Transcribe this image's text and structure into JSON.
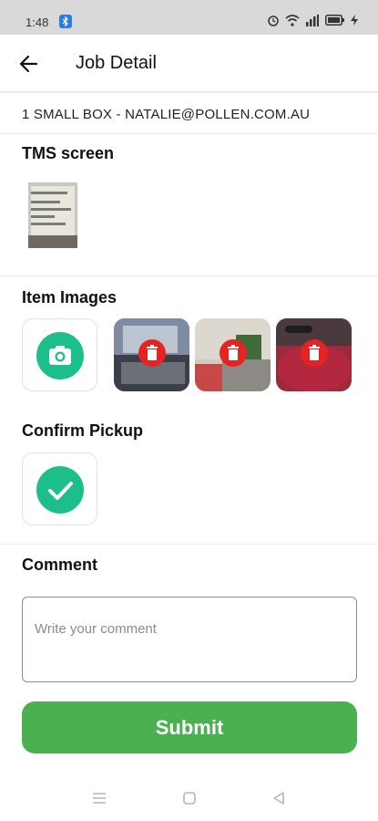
{
  "status_bar": {
    "time": "1:48"
  },
  "appbar": {
    "title": "Job Detail"
  },
  "job": {
    "summary": "1 SMALL BOX -  NATALIE@POLLEN.COM.AU"
  },
  "sections": {
    "tms": "TMS screen",
    "item_images": "Item Images",
    "confirm_pickup": "Confirm Pickup",
    "comment": "Comment"
  },
  "comment": {
    "placeholder": "Write your comment"
  },
  "submit": {
    "label": "Submit"
  },
  "colors": {
    "accent_teal": "#1cbf8a",
    "submit_green": "#4bb04f",
    "delete_red": "#e52323"
  }
}
